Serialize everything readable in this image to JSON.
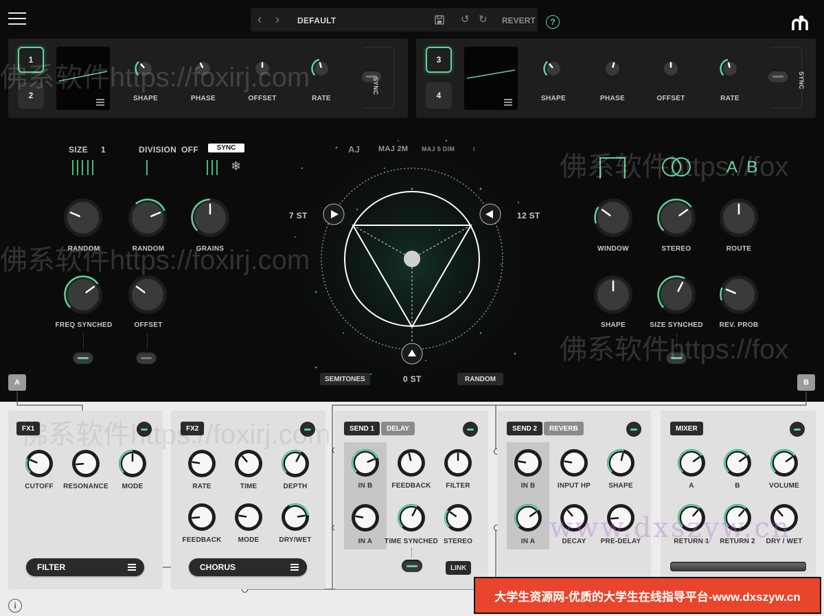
{
  "topbar": {
    "preset_name": "DEFAULT",
    "revert_label": "REVERT",
    "help_icon": "question-circle-icon",
    "save_icon": "floppy-icon",
    "logo_icon": "plugin-logo-icon"
  },
  "lfo_left": {
    "slots": [
      "1",
      "2"
    ],
    "knobs": [
      "SHAPE",
      "PHASE",
      "OFFSET",
      "RATE"
    ],
    "sync_label": "SYNC"
  },
  "lfo_right": {
    "slots": [
      "3",
      "4"
    ],
    "knobs": [
      "SHAPE",
      "PHASE",
      "OFFSET",
      "RATE"
    ],
    "sync_label": "SYNC"
  },
  "grain": {
    "size_label": "SIZE",
    "size_value": "1",
    "division_label": "DIVISION",
    "division_value": "OFF",
    "sync_button": "SYNC",
    "knob_labels": [
      "RANDOM",
      "RANDOM",
      "GRAINS",
      "FREQ SYNCHED",
      "OFFSET"
    ]
  },
  "pitch": {
    "chords": [
      "AJ",
      "MAJ 2M",
      "MAJ 5 DIM",
      "I"
    ],
    "left_value": "7 ST",
    "right_value": "12 ST",
    "bottom_value": "0 ST",
    "semitones_button": "SEMITONES",
    "random_button": "RANDOM"
  },
  "window": {
    "ab_label": "A B",
    "knob_labels": [
      "WINDOW",
      "STEREO",
      "ROUTE",
      "SHAPE",
      "SIZE SYNCHED",
      "REV. PROB"
    ]
  },
  "routing": {
    "a_label": "A",
    "b_label": "B"
  },
  "fx1": {
    "tag": "FX1",
    "knobs": [
      "CUTOFF",
      "RESONANCE",
      "MODE"
    ],
    "selector": "FILTER"
  },
  "fx2": {
    "tag": "FX2",
    "knobs": [
      "RATE",
      "TIME",
      "DEPTH",
      "FEEDBACK",
      "MODE",
      "DRY/WET"
    ],
    "selector": "CHORUS"
  },
  "send1": {
    "tag": "SEND 1",
    "type": "DELAY",
    "knobs": [
      "IN B",
      "FEEDBACK",
      "FILTER",
      "IN A",
      "TIME SYNCHED",
      "STEREO"
    ],
    "link_button": "LINK"
  },
  "send2": {
    "tag": "SEND 2",
    "type": "REVERB",
    "knobs": [
      "IN B",
      "INPUT HP",
      "SHAPE",
      "IN A",
      "DECAY",
      "PRE-DELAY"
    ]
  },
  "mixer": {
    "tag": "MIXER",
    "knobs": [
      "A",
      "B",
      "VOLUME",
      "RETURN 1",
      "RETURN 2",
      "DRY / WET"
    ]
  },
  "watermark": {
    "text": "佛系软件https://foxirj.com",
    "text_short": "佛系软件https://fox",
    "site": "www.dxszyw.cn",
    "banner": "大学生资源网-优质的大学生在线指导平台-www.dxszyw.cn"
  },
  "info_icon": "info-circle-icon",
  "colors": {
    "accent": "#5fd39a",
    "dark_bg": "#0b0b0b",
    "panel_bg": "#e0e0e0",
    "banner_bg": "#e8452c"
  }
}
